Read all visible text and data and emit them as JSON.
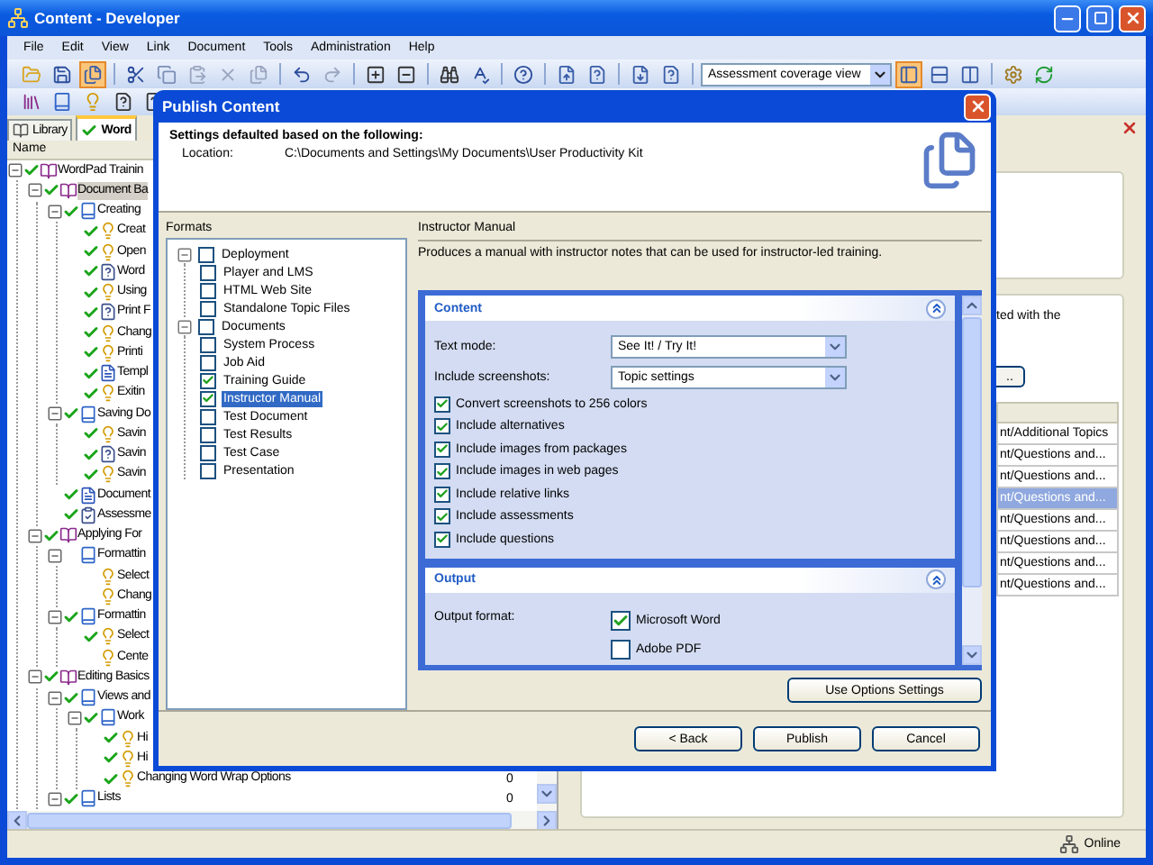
{
  "window": {
    "title": "Content - Developer"
  },
  "menu": [
    "File",
    "Edit",
    "View",
    "Link",
    "Document",
    "Tools",
    "Administration",
    "Help"
  ],
  "toolbar": {
    "view_select": "Assessment coverage view",
    "view_buttons": [
      {
        "selected": true
      },
      {
        "selected": false
      },
      {
        "selected": false
      }
    ]
  },
  "tabs": [
    {
      "label": "Library",
      "selected": false
    },
    {
      "label": "Word",
      "selected": true
    }
  ],
  "outline": {
    "column": "Name",
    "tree": [
      {
        "label": "WordPad Trainin",
        "kind": "book",
        "checked": true,
        "selected": false,
        "expanded": true,
        "children": [
          {
            "label": "Document Ba",
            "kind": "book",
            "checked": true,
            "selected": true,
            "expanded": true,
            "children": [
              {
                "label": "Creating",
                "kind": "section",
                "checked": true,
                "selected": false,
                "expanded": true,
                "children": [
                  {
                    "label": "Creat",
                    "kind": "topic",
                    "checked": true,
                    "selected": false
                  },
                  {
                    "label": "Open",
                    "kind": "topic",
                    "checked": true,
                    "selected": false
                  },
                  {
                    "label": "Word",
                    "kind": "question",
                    "checked": true,
                    "selected": false
                  },
                  {
                    "label": "Using",
                    "kind": "topic",
                    "checked": true,
                    "selected": false
                  },
                  {
                    "label": "Print F",
                    "kind": "question",
                    "checked": true,
                    "selected": false
                  },
                  {
                    "label": "Chang",
                    "kind": "topic",
                    "checked": true,
                    "selected": false
                  },
                  {
                    "label": "Printi",
                    "kind": "topic",
                    "checked": true,
                    "selected": false
                  },
                  {
                    "label": "Templ",
                    "kind": "doc",
                    "checked": true,
                    "selected": false
                  },
                  {
                    "label": "Exitin",
                    "kind": "topic",
                    "checked": true,
                    "selected": false
                  }
                ]
              },
              {
                "label": "Saving Do",
                "kind": "section",
                "checked": true,
                "selected": false,
                "expanded": true,
                "children": [
                  {
                    "label": "Savin",
                    "kind": "topic",
                    "checked": true,
                    "selected": false
                  },
                  {
                    "label": "Savin",
                    "kind": "question",
                    "checked": true,
                    "selected": false
                  },
                  {
                    "label": "Savin",
                    "kind": "topic",
                    "checked": true,
                    "selected": false
                  }
                ]
              },
              {
                "label": "Document",
                "kind": "doc",
                "checked": true,
                "selected": false
              },
              {
                "label": "Assessme",
                "kind": "assessment",
                "checked": true,
                "selected": false
              }
            ]
          },
          {
            "label": "Applying For",
            "kind": "book",
            "checked": true,
            "selected": false,
            "expanded": true,
            "children": [
              {
                "label": "Formattin",
                "kind": "section",
                "checked": false,
                "selected": false,
                "expanded": true,
                "children": [
                  {
                    "label": "Select",
                    "kind": "topic",
                    "checked": false,
                    "selected": false
                  },
                  {
                    "label": "Chang",
                    "kind": "topic",
                    "checked": false,
                    "selected": false
                  }
                ]
              },
              {
                "label": "Formattin",
                "kind": "section",
                "checked": true,
                "selected": false,
                "expanded": true,
                "children": [
                  {
                    "label": "Select",
                    "kind": "topic",
                    "checked": true,
                    "selected": false
                  },
                  {
                    "label": "Cente",
                    "kind": "topic",
                    "checked": false,
                    "selected": false
                  }
                ]
              }
            ]
          },
          {
            "label": "Editing Basics",
            "kind": "book",
            "checked": true,
            "selected": false,
            "expanded": true,
            "children": [
              {
                "label": "Views and",
                "kind": "section",
                "checked": true,
                "selected": false,
                "expanded": true,
                "children": [
                  {
                    "label": "Work",
                    "kind": "section",
                    "checked": true,
                    "selected": false,
                    "expanded": true,
                    "children": [
                      {
                        "label": "Hi",
                        "kind": "topic",
                        "checked": true,
                        "selected": false
                      },
                      {
                        "label": "Hi",
                        "kind": "topic",
                        "checked": true,
                        "selected": false
                      },
                      {
                        "label": "Changing Word Wrap Options",
                        "kind": "topic",
                        "checked": true,
                        "selected": false,
                        "count": "0"
                      }
                    ]
                  }
                ]
              },
              {
                "label": "Lists",
                "kind": "section",
                "checked": true,
                "selected": false,
                "expanded": true,
                "count": "0"
              }
            ]
          }
        ]
      }
    ]
  },
  "details": {
    "text": "ted with the",
    "button": "..",
    "rows": [
      {
        "text": "nt/Additional Topics",
        "selected": false
      },
      {
        "text": "nt/Questions and...",
        "selected": false
      },
      {
        "text": "nt/Questions and...",
        "selected": false
      },
      {
        "text": "nt/Questions and...",
        "selected": true
      },
      {
        "text": "nt/Questions and...",
        "selected": false
      },
      {
        "text": "nt/Questions and...",
        "selected": false
      },
      {
        "text": "nt/Questions and...",
        "selected": false
      },
      {
        "text": "nt/Questions and...",
        "selected": false
      }
    ]
  },
  "dialog": {
    "title": "Publish Content",
    "heading": "Settings defaulted based on the following:",
    "location_label": "Location:",
    "location": "C:\\Documents and Settings\\My Documents\\User Productivity Kit",
    "formats_label": "Formats",
    "formats": [
      {
        "label": "Deployment",
        "checked": false,
        "selected": false,
        "expanded": true,
        "children": [
          {
            "label": "Player and LMS",
            "checked": false,
            "selected": false
          },
          {
            "label": "HTML Web Site",
            "checked": false,
            "selected": false
          },
          {
            "label": "Standalone Topic Files",
            "checked": false,
            "selected": false
          }
        ]
      },
      {
        "label": "Documents",
        "checked": false,
        "selected": false,
        "expanded": true,
        "children": [
          {
            "label": "System Process",
            "checked": false,
            "selected": false
          },
          {
            "label": "Job Aid",
            "checked": false,
            "selected": false
          },
          {
            "label": "Training Guide",
            "checked": true,
            "selected": false
          },
          {
            "label": "Instructor Manual",
            "checked": true,
            "selected": true
          },
          {
            "label": "Test Document",
            "checked": false,
            "selected": false
          },
          {
            "label": "Test Results",
            "checked": false,
            "selected": false
          },
          {
            "label": "Test Case",
            "checked": false,
            "selected": false
          },
          {
            "label": "Presentation",
            "checked": false,
            "selected": false
          }
        ]
      }
    ],
    "format_title": "Instructor Manual",
    "description": "Produces a manual with instructor notes that can be used for instructor-led training.",
    "sections": [
      {
        "title": "Content",
        "expanded": true,
        "fields": [
          {
            "kind": "select",
            "label": "Text mode:",
            "value": "See It! / Try It!"
          },
          {
            "kind": "select",
            "label": "Include screenshots:",
            "value": "Topic settings"
          },
          {
            "kind": "checkbox",
            "label": "Convert screenshots to 256 colors",
            "checked": true
          },
          {
            "kind": "checkbox",
            "label": "Include alternatives",
            "checked": true
          },
          {
            "kind": "checkbox",
            "label": "Include images from packages",
            "checked": true
          },
          {
            "kind": "checkbox",
            "label": "Include images in web pages",
            "checked": true
          },
          {
            "kind": "checkbox",
            "label": "Include relative links",
            "checked": true
          },
          {
            "kind": "checkbox",
            "label": "Include assessments",
            "checked": true
          },
          {
            "kind": "checkbox",
            "label": "Include questions",
            "checked": true
          }
        ]
      },
      {
        "title": "Output",
        "expanded": true,
        "fields": [
          {
            "kind": "options",
            "label": "Output format:",
            "options": [
              {
                "label": "Microsoft Word",
                "checked": true
              },
              {
                "label": "Adobe PDF",
                "checked": false
              }
            ]
          }
        ]
      }
    ],
    "options_button": "Use Options Settings",
    "buttons": [
      "< Back",
      "Publish",
      "Cancel"
    ]
  },
  "status_bar": {
    "status": "Online"
  }
}
